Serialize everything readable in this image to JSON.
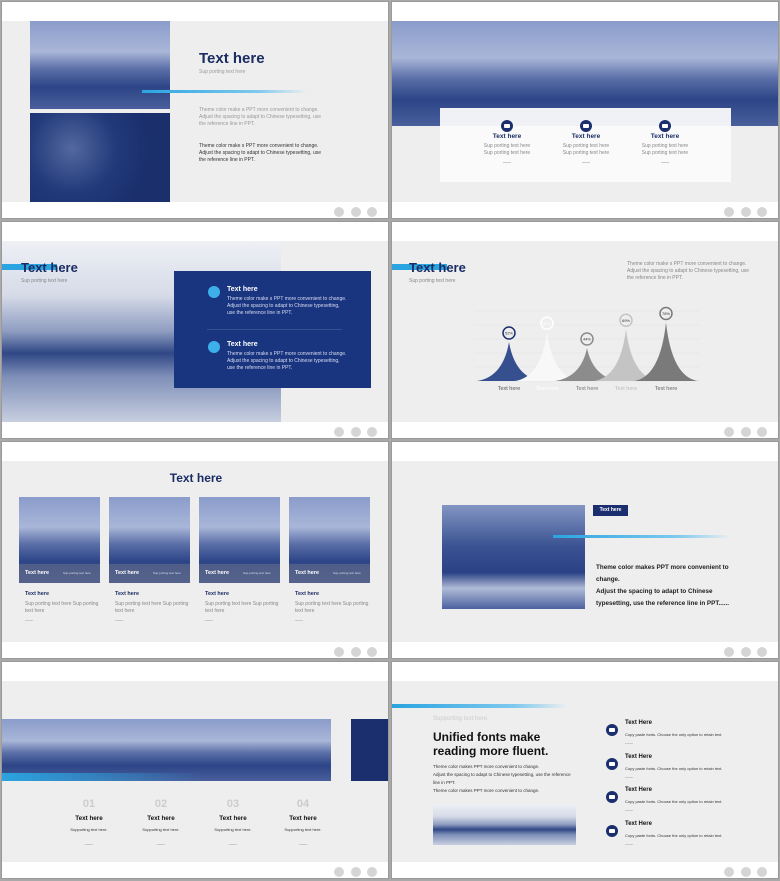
{
  "common": {
    "text_here": "Text here",
    "sup": "Sup porting text here"
  },
  "s1": {
    "title": "Text here",
    "subtitle": "Sup porting text here",
    "para1": "Theme color make a PPT more convenient to change. Adjust the spacing to adapt to Chinese typesetting, use the reference line in PPT.",
    "para2": "Theme color make s PPT more convenient to change. Adjust the spacing to adapt to Chinese typesetting, use the reference line in PPT."
  },
  "s2": {
    "items": [
      {
        "title": "Text here",
        "line1": "Sup porting text here",
        "line2": "Sup porting text here",
        "icon": "image-icon"
      },
      {
        "title": "Text here",
        "line1": "Sup porting text here",
        "line2": "Sup porting text here",
        "icon": "card-icon"
      },
      {
        "title": "Text here",
        "line1": "Sup porting text here",
        "line2": "Sup porting text here",
        "icon": "puzzle-icon"
      }
    ]
  },
  "s3": {
    "title": "Text here",
    "subtitle": "Sup porting text here",
    "items": [
      {
        "title": "Text here",
        "body": "Theme color make s PPT more convenient to change. Adjust the spacing to adapt to Chinese typesetting, use the reference line in PPT."
      },
      {
        "title": "Text here",
        "body": "Theme color make s PPT more convenient to change. Adjust the spacing to adapt to Chinese typesetting, use the reference line in PPT."
      }
    ]
  },
  "s4": {
    "title": "Text here",
    "subtitle": "Sup porting text here",
    "para": "Theme color make s PPT more convenient to change. Adjust the spacing to adapt to Chinese typesetting, use the reference line in PPT.",
    "chart_data": {
      "type": "area",
      "categories": [
        "Text here",
        "Text here",
        "Text here",
        "Text here",
        "Text here"
      ],
      "values": [
        52,
        65,
        44,
        69,
        78
      ],
      "labels": [
        "52%",
        "65%",
        "44%",
        "69%",
        "78%"
      ],
      "colors": [
        "#354f8f",
        "#f8f8f8",
        "#8c8c8c",
        "#c4c4c4",
        "#7a7a7a"
      ],
      "label_colors": [
        "#555555",
        "#ffffff",
        "#777777",
        "#bbbbbb",
        "#666666"
      ],
      "ylim": [
        0,
        100
      ],
      "grid": true
    }
  },
  "s5": {
    "title": "Text here",
    "cards": [
      {
        "overlay_title": "Text here",
        "overlay_sub": "Sup porting text here",
        "title": "Text here",
        "body": "Sup porting text here Sup porting text here"
      },
      {
        "overlay_title": "Text here",
        "overlay_sub": "Sup porting text here",
        "title": "Text here",
        "body": "Sup porting text here Sup porting text here"
      },
      {
        "overlay_title": "Text here",
        "overlay_sub": "Sup porting text here",
        "title": "Text here",
        "body": "Sup porting text here Sup porting text here"
      },
      {
        "overlay_title": "Text here",
        "overlay_sub": "Sup porting text here",
        "title": "Text here",
        "body": "Sup porting text here Sup porting text here"
      }
    ]
  },
  "s6": {
    "tag": "Text here",
    "line1": "Theme color makes PPT more convenient to change.",
    "line2": "Adjust the spacing to adapt to Chinese typesetting, use the reference line in PPT......"
  },
  "s7": {
    "steps": [
      {
        "num": "01",
        "title": "Text here",
        "sub": "Supporting text here."
      },
      {
        "num": "02",
        "title": "Text here",
        "sub": "Supporting text here."
      },
      {
        "num": "03",
        "title": "Text here",
        "sub": "Supporting text here."
      },
      {
        "num": "04",
        "title": "Text here",
        "sub": "Supporting text here."
      }
    ]
  },
  "s8": {
    "kicker": "Supporting text here.",
    "heading1": "Unified fonts make",
    "heading2": "reading more fluent.",
    "p1": "Theme color makes PPT more convenient to change.",
    "p2": "Adjust the spacing to adapt to Chinese typesetting, use the reference line in PPT.",
    "p3": "Theme color makes PPT more convenient to change.",
    "items": [
      {
        "title": "Text Here",
        "body": "Copy paste fonts. Choose the only option to retain text."
      },
      {
        "title": "Text Here",
        "body": "Copy paste fonts. Choose the only option to retain text."
      },
      {
        "title": "Text Here",
        "body": "Copy paste fonts. Choose the only option to retain text."
      },
      {
        "title": "Text Here",
        "body": "Copy paste fonts. Choose the only option to retain text."
      }
    ]
  }
}
